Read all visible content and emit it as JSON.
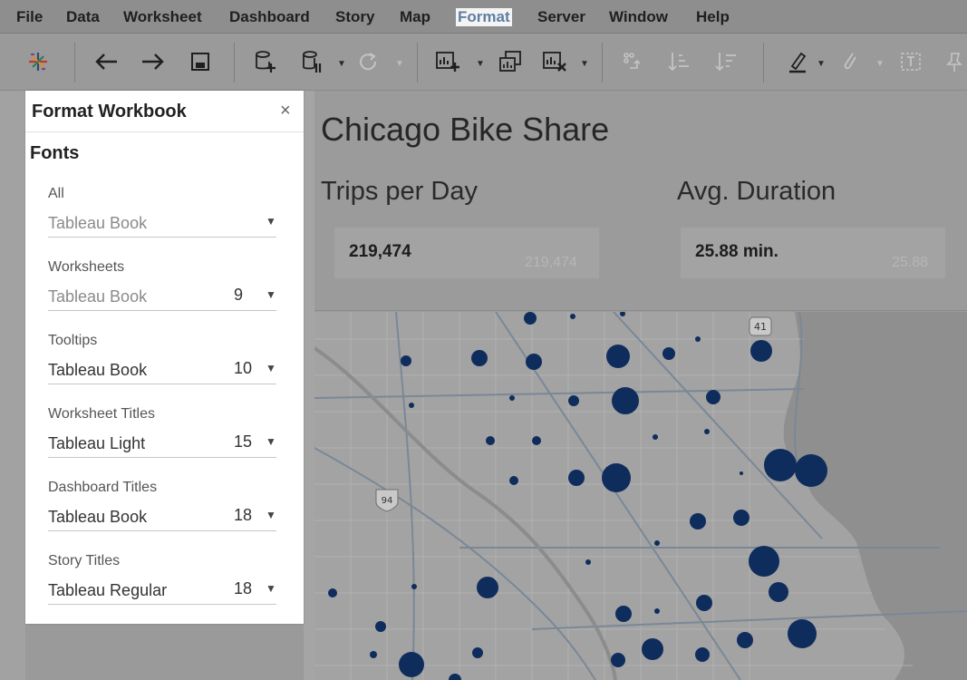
{
  "menu": {
    "items": [
      "File",
      "Data",
      "Worksheet",
      "Dashboard",
      "Story",
      "Map",
      "Format",
      "Server",
      "Window",
      "Help"
    ],
    "active": "Format"
  },
  "toolbar": {
    "icons": [
      "tableau-logo-icon",
      "undo-icon",
      "redo-icon",
      "save-icon",
      "new-data-source-icon",
      "pause-auto-updates-icon",
      "run-update-icon",
      "new-worksheet-icon",
      "duplicate-icon",
      "clear-sheet-icon",
      "swap-icon",
      "sort-ascending-icon",
      "sort-descending-icon",
      "highlight-icon",
      "group-icon",
      "show-labels-icon",
      "fix-axes-icon"
    ]
  },
  "format_panel": {
    "title": "Format Workbook",
    "close_label": "×",
    "section_title": "Fonts",
    "groups": [
      {
        "label": "All",
        "font": "Tableau Book",
        "size": "",
        "muted": true
      },
      {
        "label": "Worksheets",
        "font": "Tableau Book",
        "size": "9",
        "muted": true
      },
      {
        "label": "Tooltips",
        "font": "Tableau Book",
        "size": "10",
        "muted": false
      },
      {
        "label": "Worksheet Titles",
        "font": "Tableau Light",
        "size": "15",
        "muted": false
      },
      {
        "label": "Dashboard Titles",
        "font": "Tableau Book",
        "size": "18",
        "muted": false
      },
      {
        "label": "Story Titles",
        "font": "Tableau Regular",
        "size": "18",
        "muted": false
      }
    ]
  },
  "dashboard": {
    "title": "Chicago Bike Share",
    "kpis": [
      {
        "title": "Trips per Day",
        "value": "219,474",
        "ghost": "219,474"
      },
      {
        "title": "Avg. Duration",
        "value": "25.88 min.",
        "ghost": "25.88"
      }
    ],
    "map": {
      "highway_shields": [
        "41",
        "94"
      ],
      "point_color": "#0f2d5c"
    }
  },
  "colors": {
    "menubar": "#8e8e8e",
    "active_menu_text": "#5e7ea3",
    "panel_bg": "#ffffff",
    "dim_overlay": "#9b9b9b",
    "station_points": "#0f2d5c"
  }
}
